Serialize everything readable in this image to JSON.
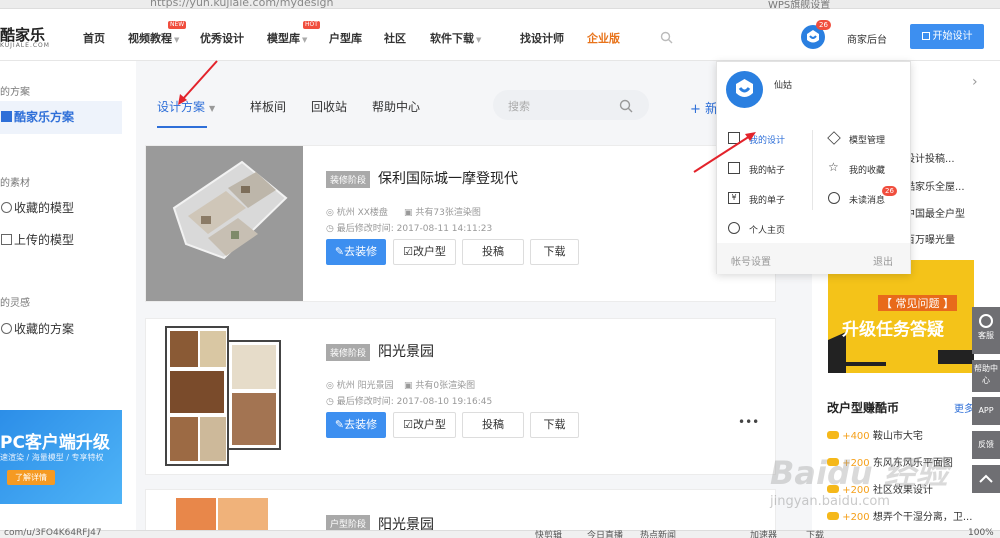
{
  "browser": {
    "url": "https://yun.kujiale.com/mydesign",
    "tab": "WPS旗舰设置"
  },
  "topnav": {
    "logo": "酷家乐",
    "logo_sub": "KUJIALE.COM",
    "items": [
      "首页",
      "视频教程",
      "优秀设计",
      "模型库",
      "户型库",
      "社区",
      "软件下载",
      "找设计师",
      "企业版"
    ],
    "tag_new": "NEW",
    "tag_hot": "HOT",
    "badge": "26",
    "merchant": "商家后台",
    "start_design": "开始设计"
  },
  "sidebar": {
    "sec1": "的方案",
    "item_kujiale": "酷家乐方案",
    "sec2": "的素材",
    "item_fav_models": "收藏的模型",
    "item_uploaded": "上传的模型",
    "sec3": "的灵感",
    "item_fav_plans": "收藏的方案",
    "banner_title": "PC客户端升级",
    "banner_sub": "速渲染 / 海量模型 / 专享特权",
    "banner_btn": "了解详情"
  },
  "tabs": {
    "design": "设计方案",
    "sample": "样板间",
    "recycle": "回收站",
    "help": "帮助中心",
    "search_placeholder": "搜索",
    "new": "新"
  },
  "projects": [
    {
      "stage": "装修阶段",
      "title": "保利国际城一摩登现代",
      "location": "杭州 XX楼盘",
      "renders": "共有73张渲染图",
      "modified": "最后修改时间: 2017-08-11 14:11:23",
      "btn_decorate": "去装修",
      "btn_modify": "改户型",
      "btn_submit": "投稿",
      "btn_download": "下载"
    },
    {
      "stage": "装修阶段",
      "title": "阳光景园",
      "location": "杭州 阳光景园",
      "renders": "共有0张渲染图",
      "modified": "最后修改时间: 2017-08-10 19:16:45",
      "btn_decorate": "去装修",
      "btn_modify": "改户型",
      "btn_submit": "投稿",
      "btn_download": "下载",
      "more": "•••"
    },
    {
      "stage": "户型阶段",
      "title": "阳光景园"
    }
  ],
  "right": {
    "news": [
      "设计投稿...",
      "酷家乐全屋...",
      "中国最全户型",
      "百万曝光量"
    ],
    "promo_tag": "【 常见问题 】",
    "promo_title": "升级任务答疑",
    "earn_title": "改户型赚酷币",
    "more": "更多",
    "earn_items": [
      {
        "coin": "+400",
        "text": "鞍山市大宅"
      },
      {
        "coin": "+200",
        "text": "东风东风乐平面图"
      },
      {
        "coin": "+200",
        "text": "社区效果设计"
      },
      {
        "coin": "+200",
        "text": "想弄个干湿分离，卫..."
      }
    ]
  },
  "dropdown": {
    "username": "仙姑",
    "items": [
      "我的设计",
      "模型管理",
      "我的帖子",
      "我的收藏",
      "我的单子",
      "未读消息",
      "个人主页"
    ],
    "unread_badge": "26",
    "settings": "帐号设置",
    "logout": "退出"
  },
  "float": {
    "service": "客服",
    "help": "帮助中心",
    "app": "APP",
    "feedback": "反馈"
  },
  "statusbar": {
    "link": "com/u/3FO4K64RFJ47",
    "quick": "快剪辑",
    "live": "今日直播",
    "news": "热点新闻",
    "speed": "加速器",
    "download": "下载",
    "zoom": "100%"
  },
  "watermark": {
    "main": "Baidu 经验",
    "sub": "jingyan.baidu.com"
  }
}
